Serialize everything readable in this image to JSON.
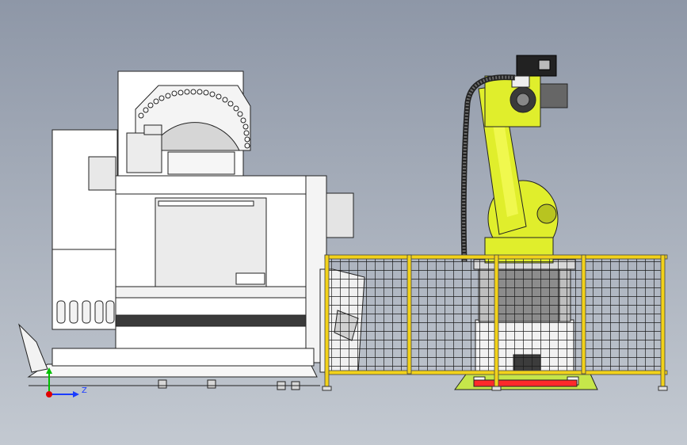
{
  "viewport": {
    "background_top": "#8e97a7",
    "background_bottom": "#c3c9d1"
  },
  "scene": {
    "objects": [
      {
        "name": "cnc-machine",
        "color": "#ffffff"
      },
      {
        "name": "robot-arm",
        "color": "#e0ee2c"
      },
      {
        "name": "safety-fence",
        "color": "#f2d21a"
      },
      {
        "name": "robot-base-pad",
        "color": "#c6e64a"
      },
      {
        "name": "floor-rail",
        "color": "#ff2a2a"
      }
    ]
  },
  "triad": {
    "axis_y_color": "#00c000",
    "axis_z_color": "#1a3cff",
    "origin_color": "#e00000",
    "z_label": "Z"
  }
}
